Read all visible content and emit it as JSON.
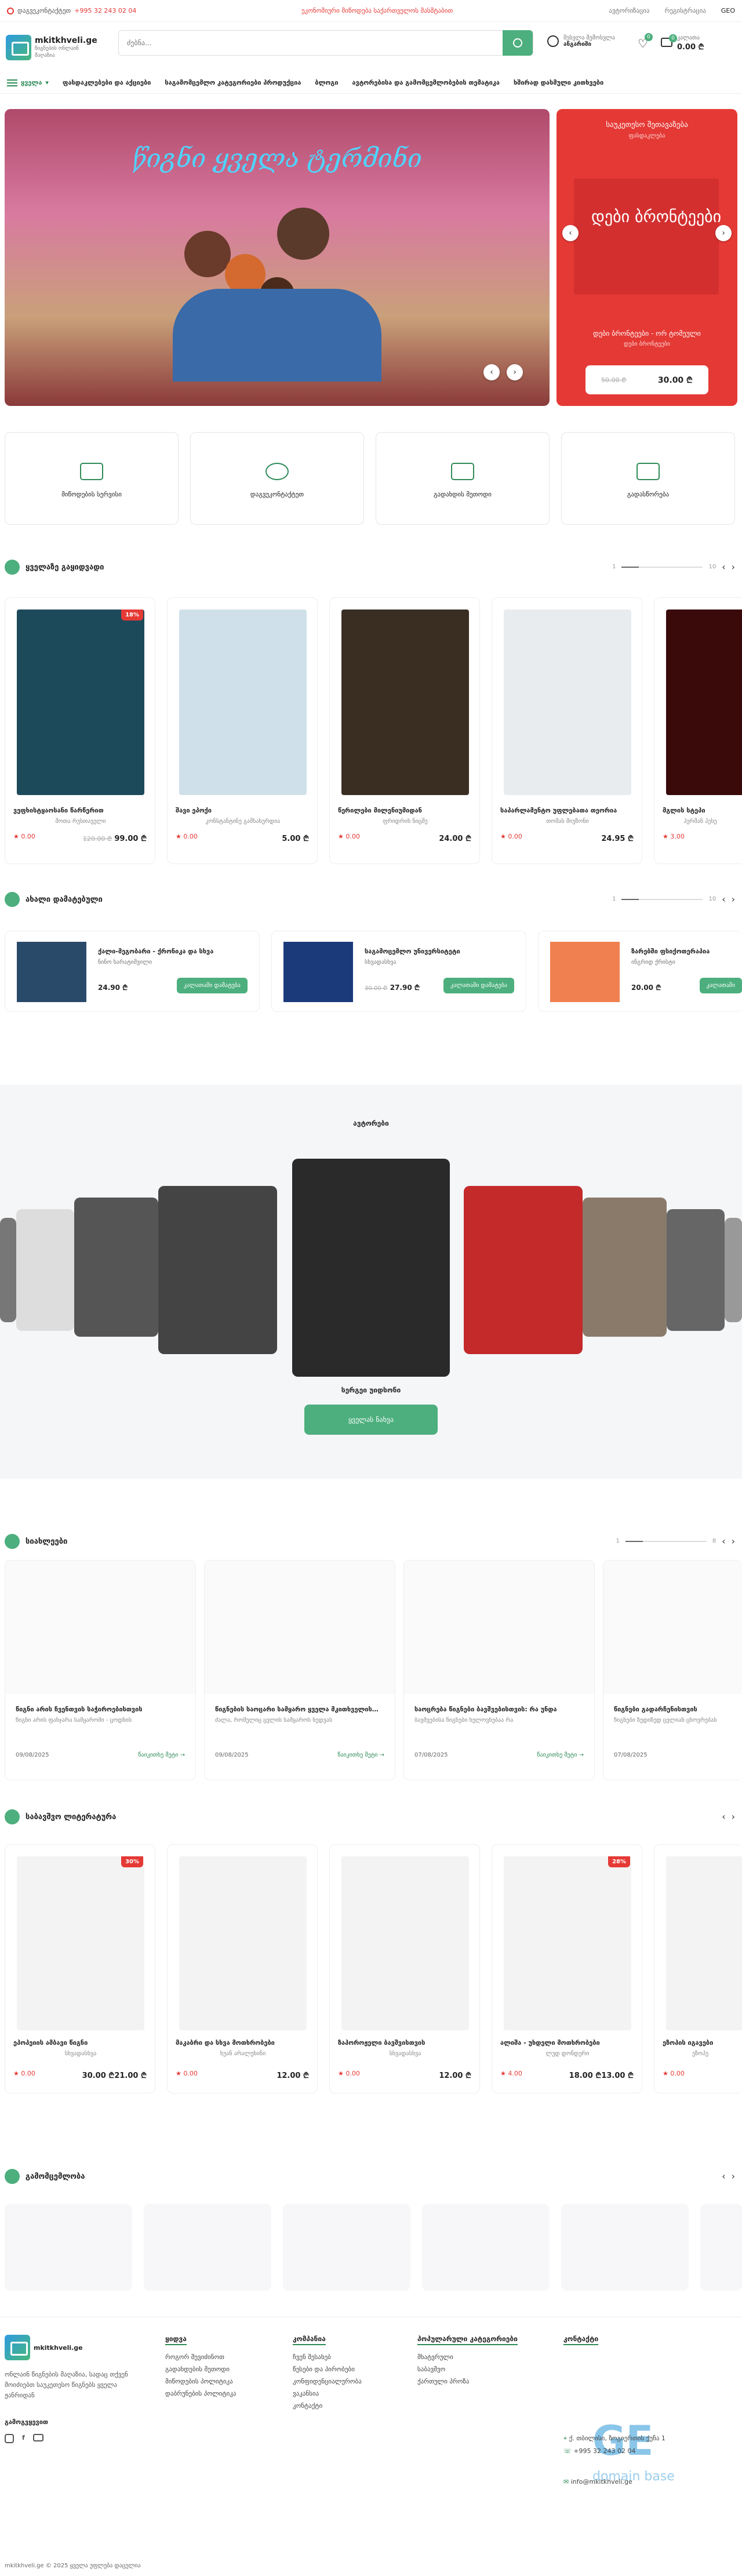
{
  "topbar": {
    "consult": "დაგვეკონტაქტეთ",
    "phone": "+995 32 243 02 04",
    "center": "ეკონომიური მიწოდება საქართველოს მასშტაბით",
    "right_links": [
      "ავტორიზაცია",
      "რეგისტრაცია"
    ],
    "lang": "GEO"
  },
  "header": {
    "logo_title": "mkitkhveli.ge",
    "logo_sub": "წიგნების ონლაინ მაღაზია",
    "search_placeholder": "ძებნა...",
    "account_line1": "შესვლა შემოსვლა",
    "account_line2": "ანგარიში",
    "wish_count": "0",
    "cart_count": "0",
    "cart_label": "კალათა",
    "cart_total": "0.00 ₾"
  },
  "nav": {
    "all": "ყველა",
    "items": [
      "ფასდაკლებები და აქციები",
      "საგამომცემლო კატეგორიები პროდუქცია",
      "ბლოგი",
      "ავტორებისა და გამომცემლობების თემატიკა",
      "ხშირად დასმული კითხვები"
    ]
  },
  "hero": {
    "title": "წიგნი ყველა ტერმინი"
  },
  "promo": {
    "label": "საუკეთესო შეთავაზება",
    "sub": "ფასდაკლება",
    "book_title": "დები ბრონტეები",
    "caption": "დები ბრონტეები - ორ ტომეული",
    "caption_sub": "დები ბრონტეები",
    "old": "50.00 ₾",
    "price": "30.00 ₾"
  },
  "features": [
    "მიწოდების სერვისი",
    "დაგვეკონტაქტეთ",
    "გადახდის მეთოდი",
    "გადასწორება"
  ],
  "popular": {
    "title": "ყველაზე გაყიდვადი",
    "cards": [
      {
        "name": "ვეფხისტყაოსანი წარწერით",
        "author": "შოთა რუსთაველი",
        "rating": "0.00",
        "old": "120.00 ₾",
        "price": "99.00 ₾",
        "disc": "18%",
        "color": "#1d4a5a"
      },
      {
        "name": "შავი ეპოქი",
        "author": "კონსტანტინე გამსახურდია",
        "rating": "0.00",
        "old": "",
        "price": "5.00 ₾",
        "disc": "",
        "color": "#cfe0ea"
      },
      {
        "name": "წერილები მილენიუმიდან",
        "author": "ფრიდრიხ ნიცშე",
        "rating": "0.00",
        "old": "",
        "price": "24.00 ₾",
        "disc": "",
        "color": "#3a2e22"
      },
      {
        "name": "საპარლამენტო უფლებათა თეორია",
        "author": "თომას მიუზონი",
        "rating": "0.00",
        "old": "",
        "price": "24.95 ₾",
        "disc": "",
        "color": "#f1f1f1"
      },
      {
        "name": "მგლის სტეპი",
        "author": "ჰერმან ჰესე",
        "rating": "3.00",
        "old": "",
        "price": "",
        "disc": "",
        "color": "#3a0a0a"
      }
    ]
  },
  "newarr": {
    "title": "ახალი დამატებული",
    "cards": [
      {
        "name": "ქალი-მეგობარი - ქრონიკა და სხვა",
        "author": "ნინო ხარატიშვილი",
        "price": "24.90 ₾",
        "old": "",
        "btn": "კალათაში დამატება",
        "color": "#2a4a6a"
      },
      {
        "name": "საგამოცემლო უნივერსიტეტი",
        "author": "სხვადასხვა",
        "price": "27.90 ₾",
        "old": "30.00 ₾",
        "btn": "კალათაში დამატება",
        "color": "#1a3a7a"
      },
      {
        "name": "ზარებში ფსიქოთერაპია",
        "author": "ინგრიდ ქრისტი",
        "price": "20.00 ₾",
        "old": "",
        "btn": "კალათაში",
        "color": "#f08050"
      }
    ]
  },
  "authors": {
    "title": "ავტორები",
    "featured": "სერგეი უიდსონი",
    "button": "ყველას ნახვა"
  },
  "blog": {
    "title": "სიახლეები",
    "posts": [
      {
        "title": "წიგნი არის ჩვენთვის საჭიროებისთვის",
        "desc": "წიგნი არის ფანჯარა სამყაროში - ცოდნის",
        "date": "09/08/2025",
        "more": "წაიკითხე მეტი →"
      },
      {
        "title": "წიგნების საოცარი სამყარო ყველა მკითხველისთვის",
        "desc": "ძალა, რომელიც ცვლის სამყაროს ხედვას",
        "date": "09/08/2025",
        "more": "წაიკითხე მეტი →"
      },
      {
        "title": "საოცრება წიგნები ბავშვებისთვის: რა უნდა",
        "desc": "ბავშვებისა წიგნები ხელოვნებაა რა",
        "date": "07/08/2025",
        "more": "წაიკითხე მეტი →"
      },
      {
        "title": "წიგნები გადარჩენისთვის",
        "desc": "წიგნები ზედიზედ ცვლიან ცხოვრებას",
        "date": "07/08/2025",
        "more": "წაიკითხე მეტი →"
      }
    ]
  },
  "classic": {
    "title": "საბავშვო ლიტერატურა",
    "cards": [
      {
        "name": "ეპოპეიის ამბავი წიგნი",
        "author": "სხვადასხვა",
        "rating": "0.00",
        "old": "30.00 ₾",
        "price": "21.00 ₾",
        "disc": "30%"
      },
      {
        "name": "მაკაბრი და სხვა მოთხრობები",
        "author": "ხუან არალეხინი",
        "rating": "0.00",
        "old": "",
        "price": "12.00 ₾",
        "disc": ""
      },
      {
        "name": "ზაპოროჟელი ბავშვისთვის",
        "author": "სხვადასხვა",
        "rating": "0.00",
        "old": "",
        "price": "12.00 ₾",
        "disc": ""
      },
      {
        "name": "ალიშა - უხდელი მოთხრობები",
        "author": "ლუდ დონდერი",
        "rating": "4.00",
        "old": "18.00 ₾",
        "price": "13.00 ₾",
        "disc": "28%"
      },
      {
        "name": "ეზოპის იგავები",
        "author": "ეზოპე",
        "rating": "0.00",
        "old": "",
        "price": "",
        "disc": ""
      }
    ]
  },
  "publishers": {
    "title": "გამომცემლობა"
  },
  "footer": {
    "logo": "mkitkhveli.ge",
    "about": "ონლაინ წიგნების მაღაზია, სადაც თქვენ მოიძიებთ საუკეთესო წიგნებს ყველა ჟანრიდან",
    "follow": "გამოგვყევით",
    "cols": [
      {
        "title": "ყიდვა",
        "items": [
          "როგორ შევიძინოთ",
          "გადახდების მეთოდი",
          "მიწოდების პოლიტიკა",
          "დაბრუნების პოლიტიკა"
        ]
      },
      {
        "title": "კომპანია",
        "items": [
          "ჩვენ შესახებ",
          "წესები და პირობები",
          "კონფიდენციალურობა",
          "ვაკანსია",
          "კონტაქტი"
        ]
      },
      {
        "title": "პოპულარული კატეგორიები",
        "items": [
          "მხატვრული",
          "საბავშვო",
          "ქართული პროზა"
        ]
      },
      {
        "title": "კონტაქტი",
        "items": [
          "ქ. თბილისი, ზოგიერთის ქუჩა 1",
          "+995 32 243 02 04",
          "info@mkitkhveli.ge"
        ]
      }
    ],
    "copyright": "mkitkhveli.ge © 2025 ყველა უფლება დაცულია",
    "watermark": "GE",
    "watermark_sub": "domain base"
  }
}
